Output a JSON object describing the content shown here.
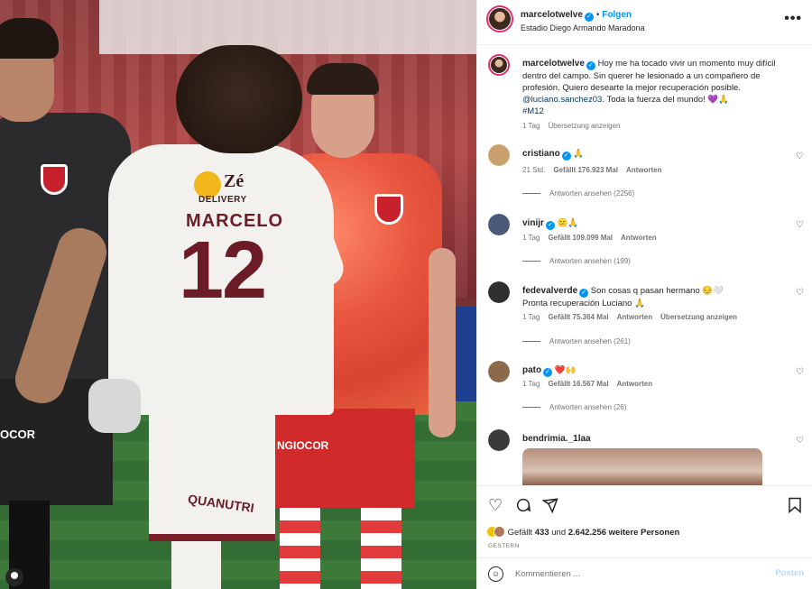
{
  "post": {
    "username": "marcelotwelve",
    "separator": "•",
    "follow_label": "Folgen",
    "location": "Estadio Diego Armando Maradona",
    "more_label": "•••",
    "caption": {
      "text_1": "Hoy me ha tocado vivir un momento muy difícil dentro del campo. Sin querer he lesionado a un compañero de profesión. Quiero desearte la mejor recuperación posible. ",
      "mention": "@luciano.sanchez03",
      "text_2": ". Toda la fuerza del mundo! 💜🙏",
      "hashtag": "#M12",
      "age": "1 Tag",
      "translate": "Übersetzung anzeigen"
    }
  },
  "photo": {
    "jersey_sponsor": "Zé",
    "jersey_sponsor_sub": "DELIVERY",
    "jersey_name": "MARCELO",
    "jersey_number": "12",
    "shorts_text": "QUANUTRI",
    "black_shorts_sponsor": "OCOR",
    "red_shorts_sponsor": "NGIOCOR"
  },
  "comments": [
    {
      "username": "cristiano",
      "verified": true,
      "text": "🙏",
      "age": "21 Std.",
      "likes": "Gefällt 176.923 Mal",
      "reply": "Antworten",
      "translate": "",
      "replies": "Antworten ansehen (2256)",
      "avatar_color": "#c9a16e"
    },
    {
      "username": "vinijr",
      "verified": true,
      "text": "😕🙏",
      "age": "1 Tag",
      "likes": "Gefällt 109.099 Mal",
      "reply": "Antworten",
      "translate": "",
      "replies": "Antworten ansehen (199)",
      "avatar_color": "#4b5876"
    },
    {
      "username": "fedevalverde",
      "verified": true,
      "text": "Son cosas q pasan hermano 😔🤍\nPronta recuperación Luciano 🙏",
      "age": "1 Tag",
      "likes": "Gefällt 75.364 Mal",
      "reply": "Antworten",
      "translate": "Übersetzung anzeigen",
      "replies": "Antworten ansehen (261)",
      "avatar_color": "#2f2f2f"
    },
    {
      "username": "pato",
      "verified": true,
      "text": "❤️🙌",
      "age": "1 Tag",
      "likes": "Gefällt 16.567 Mal",
      "reply": "Antworten",
      "translate": "",
      "replies": "Antworten ansehen (26)",
      "avatar_color": "#8a6a4a"
    },
    {
      "username": "bendrimia._1laa",
      "verified": false,
      "text": "",
      "avatar_color": "#3a3a3a"
    }
  ],
  "actions": {
    "like_icon": "heart-outline-icon",
    "comment_icon": "comment-bubble-icon",
    "share_icon": "paper-plane-icon",
    "save_icon": "bookmark-icon",
    "likes_prefix": "Gefällt ",
    "likes_count": "433",
    "likes_mid": " und ",
    "likes_others": "2.642.256 weitere Personen",
    "date": "GESTERN"
  },
  "comment_box": {
    "placeholder": "Kommentieren ...",
    "post_label": "Posten"
  },
  "colors": {
    "accent": "#0095f6",
    "secondary_text": "#737373",
    "post_disabled": "#b2dffc"
  }
}
